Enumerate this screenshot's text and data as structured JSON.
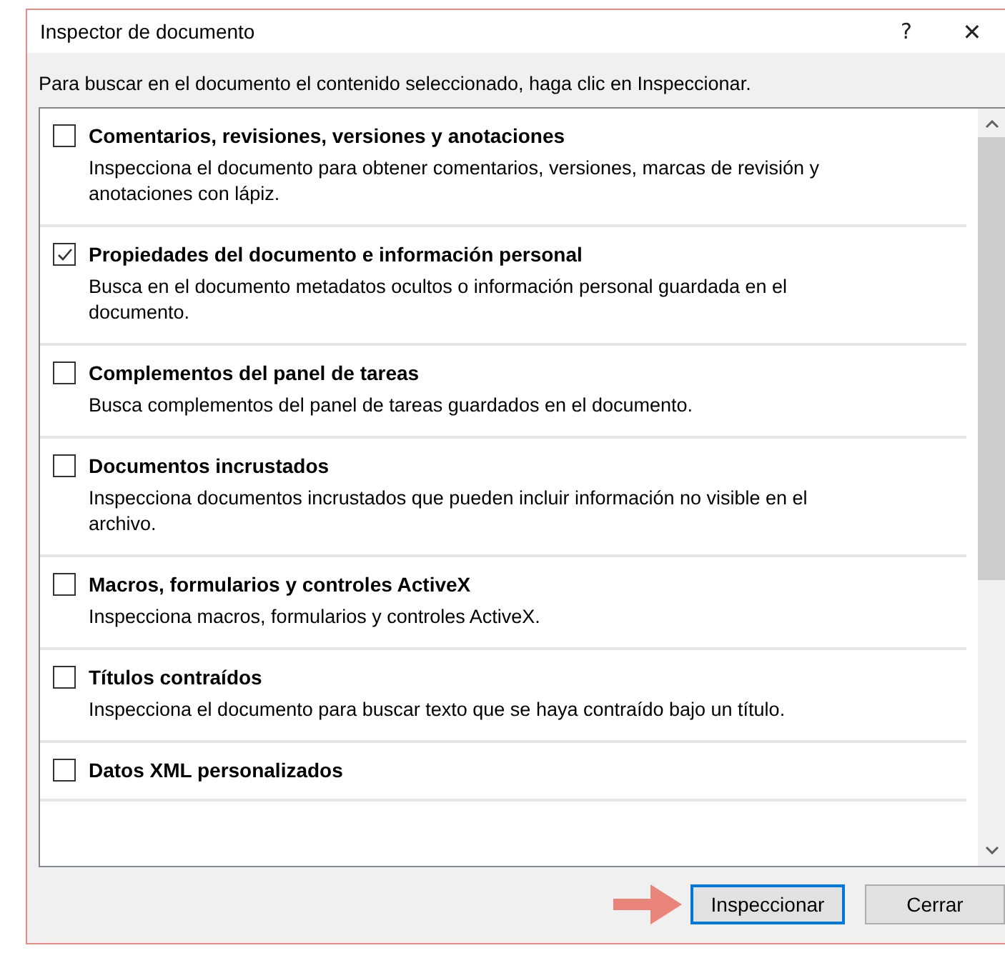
{
  "window": {
    "title": "Inspector de documento",
    "help": "?",
    "close": "✕"
  },
  "instruction": "Para buscar en el documento el contenido seleccionado, haga clic en Inspeccionar.",
  "items": [
    {
      "title": "Comentarios, revisiones, versiones y anotaciones",
      "description": "Inspecciona el documento para obtener comentarios, versiones, marcas de revisión y anotaciones con lápiz.",
      "checked": false
    },
    {
      "title": "Propiedades del documento e información personal",
      "description": "Busca en el documento metadatos ocultos o información personal guardada en el documento.",
      "checked": true
    },
    {
      "title": "Complementos del panel de tareas",
      "description": "Busca complementos del panel de tareas guardados en el documento.",
      "checked": false
    },
    {
      "title": "Documentos incrustados",
      "description": "Inspecciona documentos incrustados que pueden incluir información no visible en el archivo.",
      "checked": false
    },
    {
      "title": "Macros, formularios y controles ActiveX",
      "description": "Inspecciona macros, formularios y controles ActiveX.",
      "checked": false
    },
    {
      "title": "Títulos contraídos",
      "description": "Inspecciona el documento para buscar texto que se haya contraído bajo un título.",
      "checked": false
    },
    {
      "title": "Datos XML personalizados",
      "checked": false
    }
  ],
  "buttons": [
    {
      "label": "Inspeccionar",
      "default": true
    },
    {
      "label": "Cerrar",
      "default": false
    }
  ]
}
